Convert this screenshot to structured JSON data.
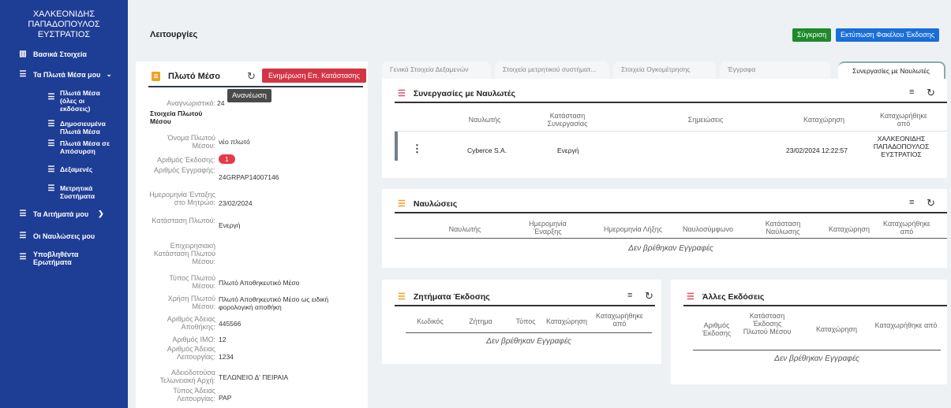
{
  "sidebar": {
    "user_name": "ΧΑΛΚΕΟΝΙΔΗΣ ΠΑΠΑΔΟΠΟΥΛΟΣ\nΕΥΣΤΡΑΤΙΟΣ",
    "items": [
      {
        "label": "Βασικά Στοιχεία",
        "icon": "building-icon"
      },
      {
        "label": "Τα Πλωτά Μέσα μου",
        "icon": "list-icon"
      },
      {
        "label": "Τα Αιτήματά μου",
        "icon": "list-icon"
      },
      {
        "label": "Οι Ναυλώσεις μου",
        "icon": "list-icon"
      },
      {
        "label": "Υποβληθέντα Ερωτήματα",
        "icon": "list-icon"
      }
    ],
    "sub_items": [
      {
        "label": "Πλωτά Μέσα (όλες οι εκδόσεις)"
      },
      {
        "label": "Δημοσιευμένα Πλωτά Μέσα"
      },
      {
        "label": "Πλωτά Μέσα σε Απόσυρση"
      },
      {
        "label": "Δεξαμενές"
      },
      {
        "label": "Μετρητικά Συστήματα"
      }
    ]
  },
  "header": {
    "title": "Λειτουργίες",
    "compare_label": "Σύγκριση",
    "print_label": "Εκτύπωση Φακέλου Έκδοσης"
  },
  "left_card": {
    "title": "Πλωτό Μέσο",
    "update_status_label": "Ενημέρωση Επ. Κατάστασης",
    "tooltip": "Ανανέωση",
    "id_label": "Αναγνωριστικό:",
    "id_value": "24",
    "section_label": "Στοιχεία Πλωτού Μέσου",
    "fields": [
      {
        "label": "Όνομα Πλωτού Μέσου:",
        "value": "νέο πλωτό"
      },
      {
        "label": "Αριθμός Έκδοσης:",
        "value": "1"
      },
      {
        "label": "Αριθμός Εγγραφής:",
        "value": "24GRPAP14007146"
      },
      {
        "label": "Ημερομηνία Ένταξης στο Μητρώο:",
        "value": "23/02/2024"
      },
      {
        "label": "Κατάσταση Πλωτού:",
        "value": "Ενεργή"
      },
      {
        "label": "Επιχειρησιακή Κατάσταση Πλωτού Μέσου:",
        "value": ""
      },
      {
        "label": "Τύπος Πλωτού Μέσου:",
        "value": "Πλωτό Αποθηκευτικό Μέσο"
      },
      {
        "label": "Χρήση Πλωτού Μέσου:",
        "value": "Πλωτό Αποθηκευτικό Μέσο ως ειδική φορολογική αποθήκη"
      },
      {
        "label": "Αριθμός Άδειας Αποθήκης:",
        "value": "445566"
      },
      {
        "label": "Αριθμός IMO:",
        "value": "12"
      },
      {
        "label": "Αριθμός Άδειας Λειτουργίας:",
        "value": "1234"
      },
      {
        "label": "Αδειοδοτούσα Τελωνειακή Αρχή:",
        "value": "ΤΕΛΩΝΕΙΟ Δ' ΠΕΙΡΑΙΑ"
      },
      {
        "label": "Τύπος Άδειας Λειτουργίας:",
        "value": "PAP"
      }
    ]
  },
  "tabs": [
    {
      "label": "Γενικά Στοιχεία Δεξαμενών"
    },
    {
      "label": "Στοιχεία μετρητικού συστήματ..."
    },
    {
      "label": "Στοιχεία Ογκομέτρησης"
    },
    {
      "label": "Έγγραφα"
    },
    {
      "label": "Συνεργασίες με Ναυλωτές"
    }
  ],
  "cooperations": {
    "title": "Συνεργασίες με Ναυλωτές",
    "columns": [
      "Ναυλωτής",
      "Κατάσταση Συνεργασίας",
      "Σημειώσεις",
      "Καταχώρηση",
      "Καταχωρήθηκε από"
    ],
    "rows": [
      {
        "charterer": "Cyberce S.A.",
        "status": "Ενεργή",
        "notes": "",
        "registered": "23/02/2024 12:22:57",
        "by": "ΧΑΛΚΕΟΝΙΔΗΣ ΠΑΠΑΔΟΠΟΥΛΟΣ ΕΥΣΤΡΑΤΙΟΣ"
      }
    ]
  },
  "charters": {
    "title": "Ναυλώσεις",
    "columns": [
      "Ναυλωτής",
      "Ημερομηνία Έναρξης",
      "Ημερομηνία Λήξης",
      "Ναυλοσύμφωνο",
      "Κατάσταση Ναύλωσης",
      "Καταχώρηση",
      "Καταχωρήθηκε από"
    ],
    "empty": "Δεν βρέθηκαν Εγγραφές"
  },
  "issues": {
    "title": "Ζητήματα Έκδοσης",
    "columns": [
      "Κωδικός",
      "Ζήτημα",
      "Τύπος",
      "Καταχώρηση",
      "Καταχωρήθηκε από"
    ],
    "empty": "Δεν βρέθηκαν Εγγραφές"
  },
  "other_versions": {
    "title": "Άλλες Εκδόσεις",
    "columns": [
      "Αριθμός Έκδοσης",
      "Κατάσταση Έκδοσης Πλωτού Μέσου",
      "Καταχώρηση",
      "Καταχωρήθηκε από"
    ],
    "empty": "Δεν βρέθηκαν Εγγραφές"
  }
}
